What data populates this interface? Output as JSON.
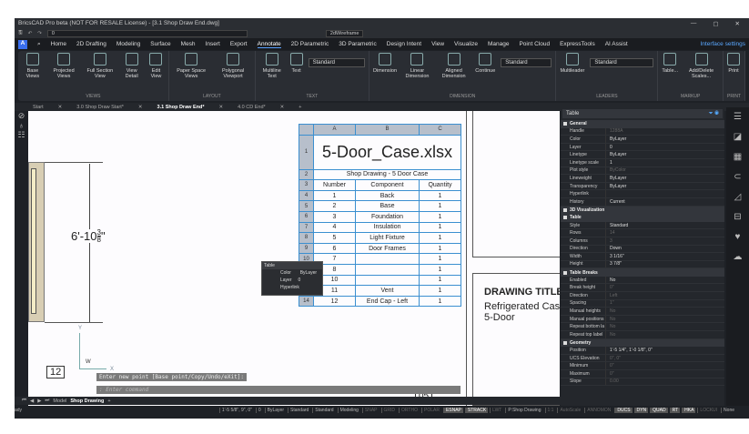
{
  "title": "BricsCAD Pro beta (NOT FOR RESALE License) - [3.1 Shop Draw End.dwg]",
  "quick_access": {
    "layer": "0",
    "visual_style": "2dWireframe"
  },
  "menu": {
    "tabs": [
      "Home",
      "2D Drafting",
      "Modeling",
      "Surface",
      "Mesh",
      "Insert",
      "Export",
      "Annotate",
      "2D Parametric",
      "3D Parametric",
      "Design Intent",
      "View",
      "Visualize",
      "Manage",
      "Point Cloud",
      "ExpressTools",
      "AI Assist"
    ],
    "active": "Annotate",
    "interface_settings": "Interface settings"
  },
  "ribbon": {
    "groups": [
      {
        "label": "VIEWS",
        "buttons": [
          "Base Views",
          "Projected Views",
          "Full Section View",
          "View Detail",
          "Edit View"
        ]
      },
      {
        "label": "LAYOUT",
        "buttons": [
          "Paper Space Views",
          "Polygonal Viewport"
        ]
      },
      {
        "label": "TEXT",
        "buttons": [
          "Multiline Text",
          "Text"
        ],
        "dropdown": "Standard"
      },
      {
        "label": "DIMENSION",
        "buttons": [
          "Dimension",
          "Linear Dimension",
          "Aligned Dimension",
          "Continue"
        ],
        "dropdown": "Standard"
      },
      {
        "label": "LEADERS",
        "buttons": [
          "Multileader"
        ],
        "dropdown": "Standard"
      },
      {
        "label": "MARKUP",
        "buttons": [
          "Table...",
          "Add/Delete Scales..."
        ]
      },
      {
        "label": "PRINT",
        "buttons": [
          "Print"
        ]
      }
    ]
  },
  "doc_tabs": [
    "Start",
    "3.0 Shop Draw Start*",
    "3.1 Shop Draw End*",
    "4.0 CD End*"
  ],
  "active_doc": "3.1 Shop Draw End*",
  "drawing": {
    "dimension": "6'-10",
    "dim_num": "3",
    "dim_den": "8",
    "dim_unit": "\"",
    "bubble1": "12",
    "bubble2": "05",
    "title_label": "DRAWING TITLE",
    "title_line1": "Refrigerated Case",
    "title_line2": "5-Door",
    "ucs_y": "Y",
    "ucs_x": "X",
    "ucs_w": "W"
  },
  "table": {
    "cols": [
      "A",
      "B",
      "C"
    ],
    "title": "5-Door_Case.xlsx",
    "subtitle": "Shop Drawing -  5 Door Case",
    "headers": [
      "Number",
      "Component",
      "Quantity"
    ],
    "rows": [
      [
        "1",
        "Back",
        "1"
      ],
      [
        "2",
        "Base",
        "1"
      ],
      [
        "3",
        "Foundation",
        "1"
      ],
      [
        "4",
        "Insulation",
        "1"
      ],
      [
        "5",
        "Light Fixture",
        "1"
      ],
      [
        "6",
        "Door Frames",
        "1"
      ],
      [
        "7",
        "",
        "1"
      ],
      [
        "8",
        "",
        "1"
      ],
      [
        "10",
        "",
        "1"
      ],
      [
        "11",
        "Vent",
        "1"
      ],
      [
        "12",
        "End Cap - Left",
        "1"
      ]
    ],
    "row_nums": [
      "1",
      "2",
      "3",
      "4",
      "5",
      "6",
      "7",
      "8",
      "9",
      "10",
      "11",
      "12",
      "13",
      "14"
    ]
  },
  "tooltip": {
    "title": "Table",
    "color_k": "Color",
    "color_v": "ByLayer",
    "layer_k": "Layer",
    "layer_v": "0",
    "hyperlink": "Hyperlink"
  },
  "command": {
    "prompt": "Enter new point [Base point/Copy/Undo/eXit]:",
    "placeholder": ": Enter command"
  },
  "props": {
    "selector": "Table",
    "sections": [
      {
        "name": "General",
        "rows": [
          [
            "Handle",
            "1288A",
            1
          ],
          [
            "Color",
            "ByLayer",
            0
          ],
          [
            "Layer",
            "0",
            0
          ],
          [
            "Linetype",
            "ByLayer",
            0
          ],
          [
            "Linetype scale",
            "1",
            0
          ],
          [
            "Plot style",
            "ByColor",
            1
          ],
          [
            "Lineweight",
            "ByLayer",
            0
          ],
          [
            "Transparency",
            "ByLayer",
            0
          ],
          [
            "Hyperlink",
            "",
            0
          ],
          [
            "History",
            "Current",
            0
          ]
        ]
      },
      {
        "name": "3D Visualization",
        "rows": []
      },
      {
        "name": "Table",
        "rows": [
          [
            "Style",
            "Standard",
            0
          ],
          [
            "Rows",
            "14",
            1
          ],
          [
            "Columns",
            "3",
            1
          ],
          [
            "Direction",
            "Down",
            0
          ],
          [
            "Width",
            "3 1/16\"",
            0
          ],
          [
            "Height",
            "3 7/8\"",
            0
          ]
        ]
      },
      {
        "name": "Table Breaks",
        "rows": [
          [
            "Enabled",
            "No",
            0
          ],
          [
            "Break height",
            "0\"",
            1
          ],
          [
            "Direction",
            "Left",
            1
          ],
          [
            "Spacing",
            "1\"",
            1
          ],
          [
            "Manual heights",
            "No",
            1
          ],
          [
            "Manual positions",
            "No",
            1
          ],
          [
            "Repeat bottom la",
            "No",
            1
          ],
          [
            "Repeat top label",
            "No",
            1
          ]
        ]
      },
      {
        "name": "Geometry",
        "rows": [
          [
            "Position",
            "1'-5 1/4\", 1'-0 1/8\", 0\"",
            0
          ],
          [
            "UCS Elevation",
            "0\", 0\"",
            1
          ],
          [
            "Minimum",
            "0\"",
            1
          ],
          [
            "Maximum",
            "0\"",
            1
          ],
          [
            "Slope",
            "0.00",
            1
          ]
        ]
      }
    ]
  },
  "layout_tabs": {
    "model": "Model",
    "active": "Shop Drawing"
  },
  "status": {
    "left": "ady",
    "coords": "1'-5 5/8\", 9\", 0\"",
    "cells": [
      [
        "0",
        1
      ],
      [
        "ByLayer",
        1
      ],
      [
        "Standard",
        1
      ],
      [
        "Standard",
        1
      ],
      [
        "Modeling",
        1
      ],
      [
        "SNAP",
        0
      ],
      [
        "GRID",
        0
      ],
      [
        "ORTHO",
        0
      ],
      [
        "POLAR",
        0
      ],
      [
        "ESNAP",
        2
      ],
      [
        "STRACK",
        2
      ],
      [
        "LWT",
        0
      ],
      [
        "P:Shop Drawing",
        1
      ],
      [
        "1:1",
        0
      ],
      [
        "AutoScale",
        0
      ],
      [
        "ANNOMON",
        0
      ],
      [
        "DUCS",
        2
      ],
      [
        "DYN",
        2
      ],
      [
        "QUAD",
        2
      ],
      [
        "RT",
        2
      ],
      [
        "HKA",
        2
      ],
      [
        "LOCKUI",
        0
      ],
      [
        "None",
        1
      ]
    ]
  }
}
